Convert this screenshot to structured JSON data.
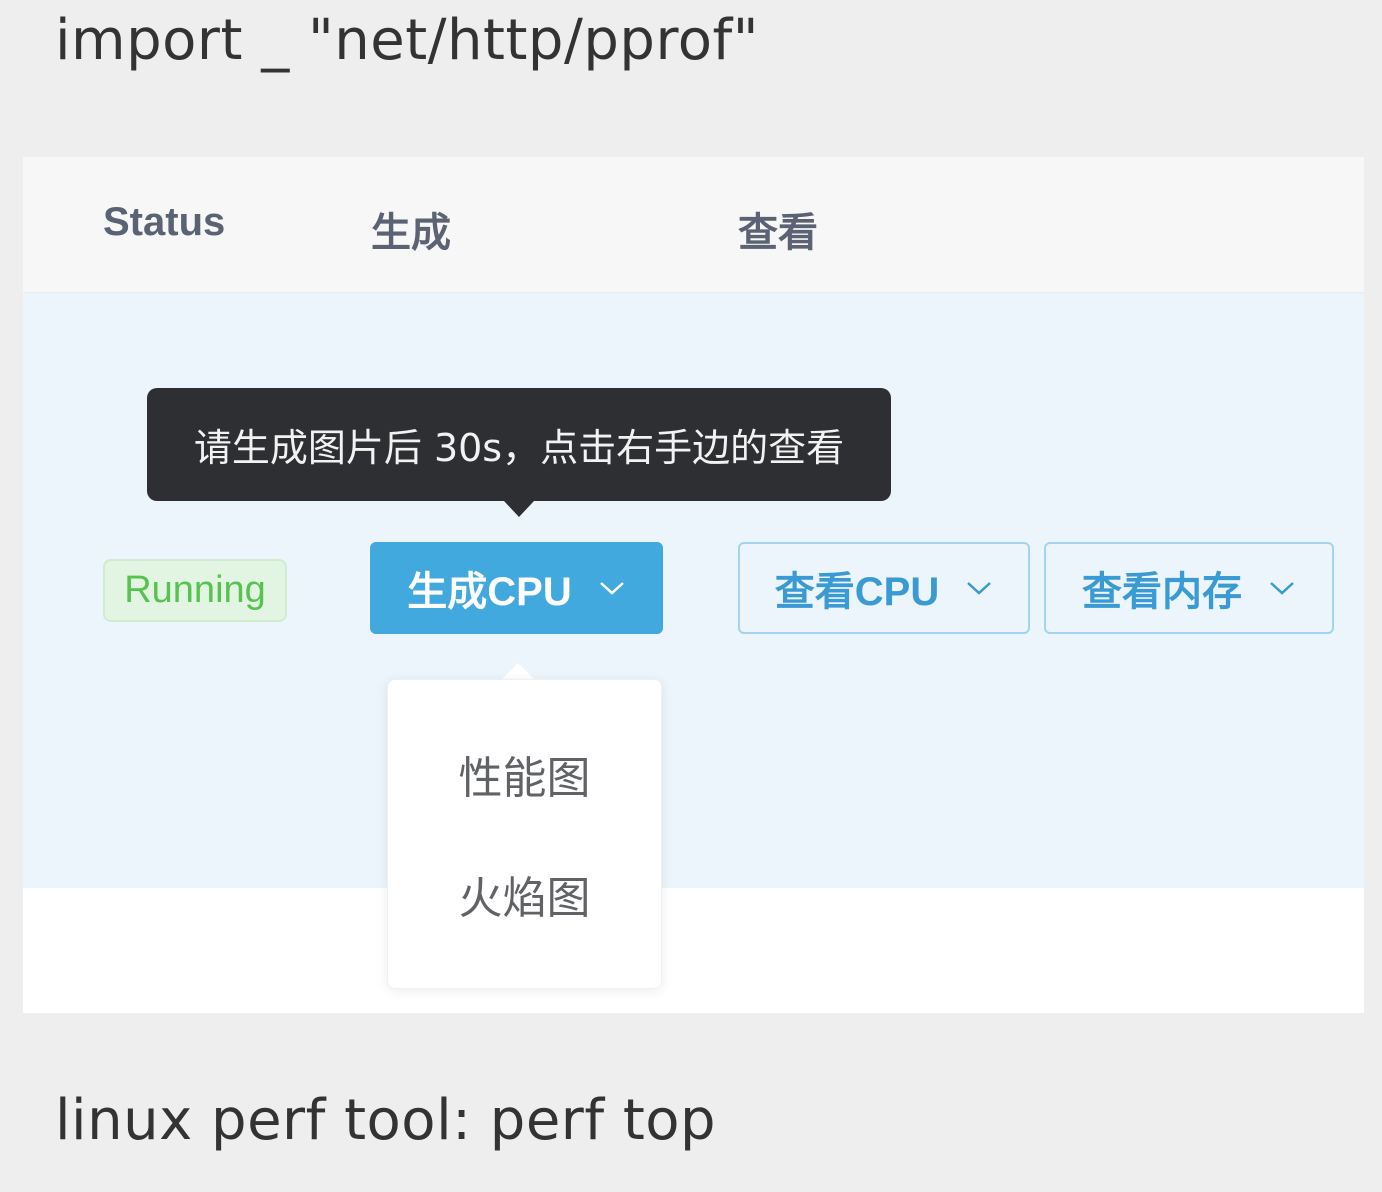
{
  "captions": {
    "top": "import _ \"net/http/pprof\"",
    "bottom": "linux perf tool: perf top"
  },
  "table": {
    "columns": [
      "Status",
      "生成",
      "查看"
    ],
    "row": {
      "status": "Running",
      "generate_button": "生成CPU",
      "view_buttons": [
        "查看CPU",
        "查看内存"
      ]
    }
  },
  "tooltip": {
    "text": "请生成图片后 30s，点击右手边的查看"
  },
  "dropdown": {
    "items": [
      "性能图",
      "火焰图"
    ]
  },
  "icons": {
    "dropdown_caret": "chevron-down-icon"
  },
  "colors": {
    "primary": "#42a9de",
    "success": "#56c24f",
    "tooltip_bg": "#2d2f33",
    "row_highlight": "#ecf5fc"
  }
}
